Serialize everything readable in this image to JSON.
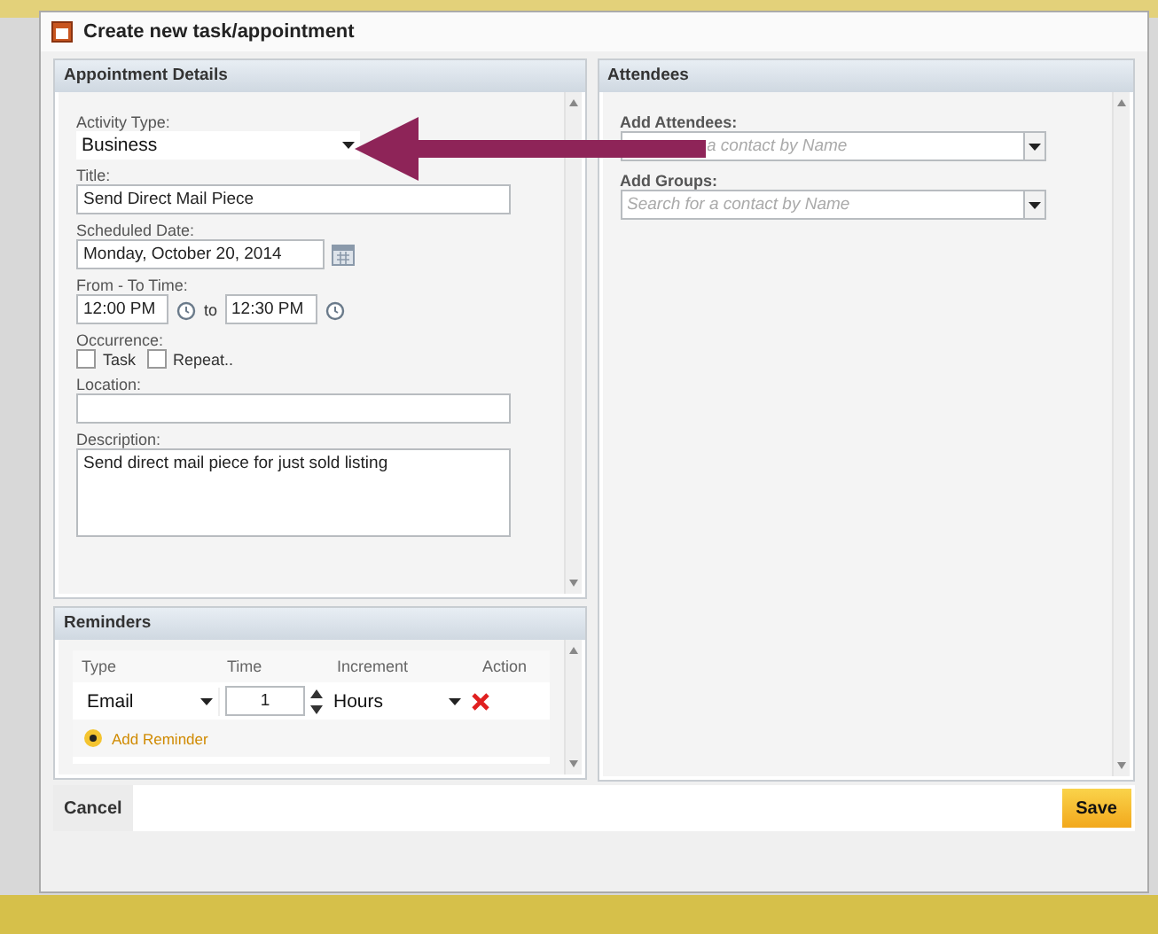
{
  "window": {
    "title": "Create new task/appointment"
  },
  "appointment_details": {
    "heading": "Appointment Details",
    "activity_type": {
      "label": "Activity Type:",
      "value": "Business"
    },
    "title": {
      "label": "Title:",
      "value": "Send Direct Mail Piece"
    },
    "scheduled_date": {
      "label": "Scheduled Date:",
      "value": "Monday, October 20, 2014"
    },
    "time": {
      "label": "From - To Time:",
      "from": "12:00 PM",
      "separator": "to",
      "to": "12:30 PM"
    },
    "occurrence": {
      "label": "Occurrence:",
      "options": [
        {
          "label": "Task",
          "checked": false
        },
        {
          "label": "Repeat..",
          "checked": false
        }
      ]
    },
    "location": {
      "label": "Location:"
    },
    "description": {
      "label": "Description:",
      "value": "Send direct mail piece for just sold listing"
    }
  },
  "reminders": {
    "heading": "Reminders",
    "columns": [
      "Type",
      "Time",
      "Increment",
      "Action"
    ],
    "rows": [
      {
        "type": "Email",
        "time": "1",
        "increment": "Hours"
      }
    ],
    "add_label": "Add Reminder"
  },
  "attendees": {
    "heading": "Attendees",
    "fields": [
      {
        "label": "Add Attendees:",
        "placeholder": "a contact by Name"
      },
      {
        "label": "Add Groups:",
        "placeholder": "Search for a contact by Name"
      }
    ]
  },
  "buttons": {
    "cancel": "Cancel",
    "save": "Save"
  }
}
